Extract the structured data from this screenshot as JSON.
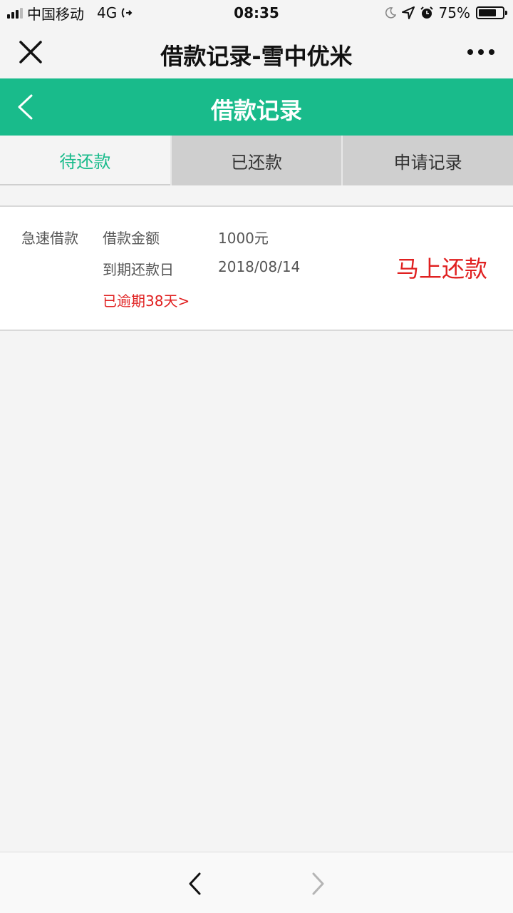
{
  "status_bar": {
    "carrier": "中国移动",
    "network": "4G",
    "time": "08:35",
    "battery": "75%",
    "battery_level": 0.75
  },
  "wechat_bar": {
    "title": "借款记录-雪中优米"
  },
  "header": {
    "title": "借款记录"
  },
  "tabs": [
    {
      "label": "待还款",
      "active": true
    },
    {
      "label": "已还款",
      "active": false
    },
    {
      "label": "申请记录",
      "active": false
    }
  ],
  "record": {
    "loan_type": "急速借款",
    "amount_label": "借款金额",
    "amount_value": "1000元",
    "due_label": "到期还款日",
    "due_value": "2018/08/14",
    "overdue_text": "已逾期38天>",
    "repay_label": "马上还款"
  },
  "colors": {
    "accent": "#19bb8b",
    "alert": "#e02020",
    "tab_inactive_bg": "#cfcfcf"
  },
  "icons": {
    "close": "close-icon",
    "more": "more-icon",
    "back": "back-arrow-icon",
    "nav_back": "chevron-left-icon",
    "nav_forward": "chevron-right-icon"
  }
}
